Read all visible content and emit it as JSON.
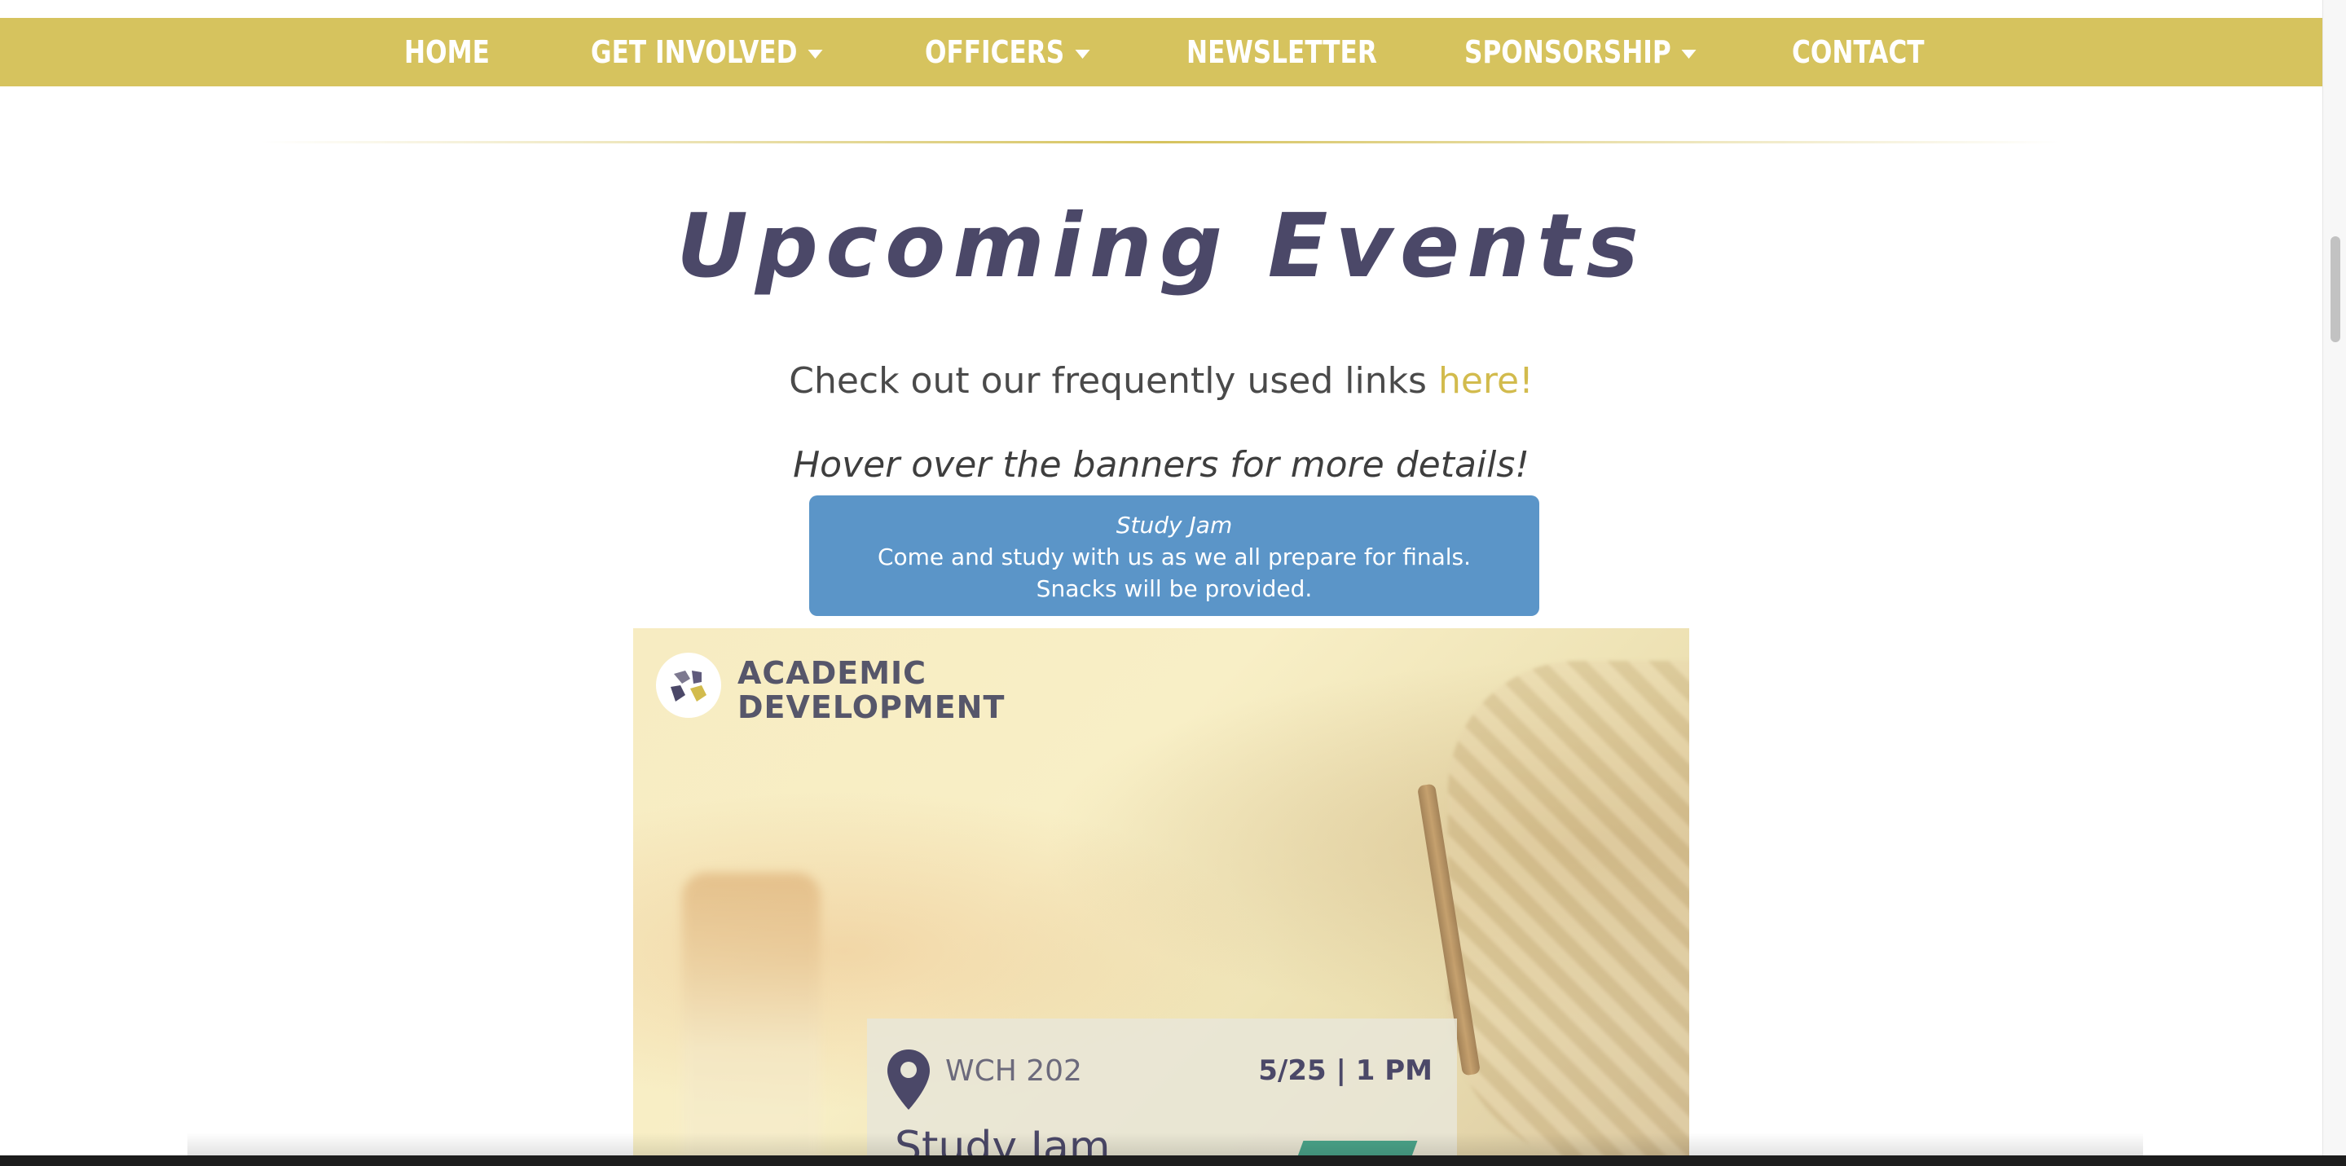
{
  "nav": {
    "items": [
      {
        "label": "HOME",
        "dropdown": false
      },
      {
        "label": "GET INVOLVED",
        "dropdown": true
      },
      {
        "label": "OFFICERS",
        "dropdown": true
      },
      {
        "label": "NEWSLETTER",
        "dropdown": false
      },
      {
        "label": "SPONSORSHIP",
        "dropdown": true
      },
      {
        "label": "CONTACT",
        "dropdown": false
      }
    ]
  },
  "main": {
    "title": "Upcoming Events",
    "links_prefix": "Check out our frequently used links ",
    "links_link": "here!",
    "hover_hint": "Hover over the banners for more details!"
  },
  "tooltip": {
    "title": "Study Jam",
    "line1": "Come and study with us as we all prepare for finals.",
    "line2": "Snacks will be provided."
  },
  "banner": {
    "logo_line1": "ACADEMIC",
    "logo_line2": "DEVELOPMENT",
    "location": "WCH 202",
    "datetime": "5/25 | 1 PM",
    "event_title": "Study Jam"
  },
  "colors": {
    "nav_bg": "#d6c35e",
    "title": "#4b4868",
    "link": "#d2bb4d",
    "tooltip_bg": "#5b95c8"
  },
  "icons": [
    "chevron-down-icon",
    "location-pin-icon",
    "academic-development-logo"
  ]
}
